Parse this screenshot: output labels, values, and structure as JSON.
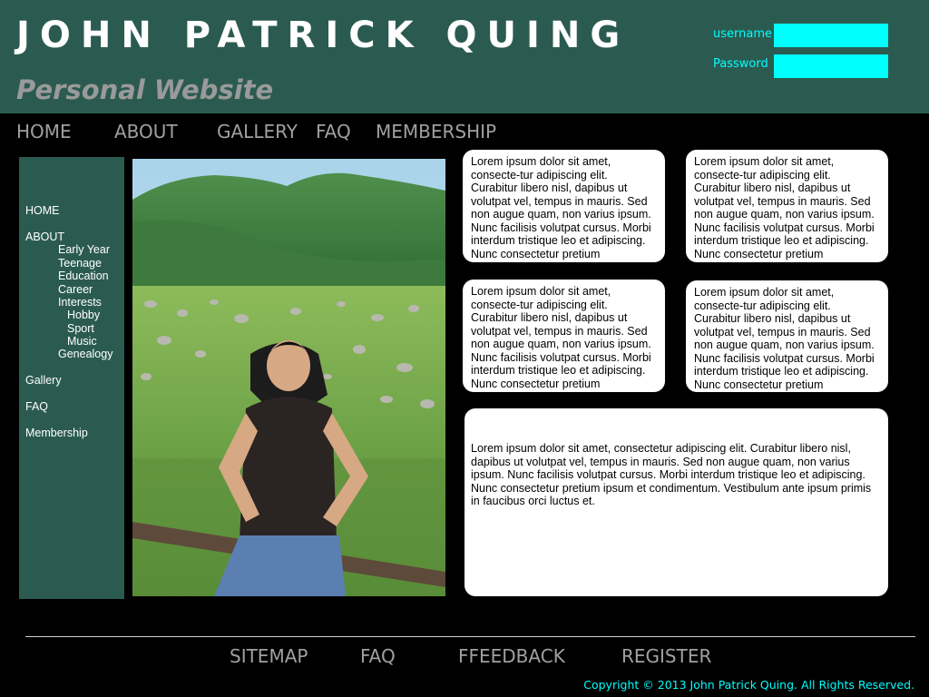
{
  "header": {
    "title": "JOHN PATRICK QUING",
    "subtitle": "Personal Website",
    "username_label": "username",
    "password_label": "Password",
    "username_value": "",
    "password_value": ""
  },
  "nav": [
    "HOME",
    "ABOUT",
    "GALLERY",
    "FAQ",
    "MEMBERSHIP"
  ],
  "sidebar": {
    "home": "HOME",
    "about": "ABOUT",
    "about_children": [
      "Early Year",
      "Teenage",
      "Education",
      "Career",
      "Interests"
    ],
    "interests_children": [
      "Hobby",
      "Sport",
      "Music"
    ],
    "genealogy": "Genealogy",
    "gallery": "Gallery",
    "faq": "FAQ",
    "membership": "Membership"
  },
  "content_boxes": [
    "Lorem ipsum dolor sit amet, consecte-tur adipiscing elit. Curabitur libero nisl, dapibus ut volutpat vel, tempus in mauris. Sed non augue quam, non varius ipsum. Nunc facilisis volutpat cursus. Morbi interdum tristique leo et adipiscing. Nunc consectetur pretium",
    "Lorem ipsum dolor sit amet, consecte-tur adipiscing elit. Curabitur libero nisl, dapibus ut volutpat vel, tempus in mauris. Sed non augue quam, non varius ipsum. Nunc facilisis volutpat cursus. Morbi interdum tristique leo et adipiscing. Nunc consectetur pretium",
    "Lorem ipsum dolor sit amet, consecte-tur adipiscing elit. Curabitur libero nisl, dapibus ut volutpat vel, tempus in mauris. Sed non augue quam, non varius ipsum. Nunc facilisis volutpat cursus. Morbi interdum tristique leo et adipiscing. Nunc consectetur pretium",
    "Lorem ipsum dolor sit amet, consecte-tur adipiscing elit. Curabitur libero nisl, dapibus ut volutpat vel, tempus in mauris. Sed non augue quam, non varius ipsum. Nunc facilisis volutpat cursus. Morbi interdum tristique leo et adipiscing. Nunc consectetur pretium"
  ],
  "wide_box": "Lorem ipsum dolor sit amet, consectetur adipiscing elit. Curabitur libero nisl, dapibus ut volutpat vel, tempus in mauris. Sed non augue quam, non varius ipsum. Nunc facilisis volutpat cursus. Morbi interdum tristique leo et adipiscing. Nunc consectetur pretium ipsum et condimentum. Vestibulum ante ipsum primis in faucibus orci luctus et.",
  "footer": {
    "links": [
      "SITEMAP",
      "FAQ",
      "FFEEDBACK",
      "REGISTER"
    ],
    "copyright": "Copyright © 2013 John Patrick Quing. All Rights Reserved."
  },
  "colors": {
    "header_bg": "#2b5b50",
    "accent": "#00ffff",
    "page_bg": "#000000",
    "nav_text": "#a0a0a0"
  }
}
